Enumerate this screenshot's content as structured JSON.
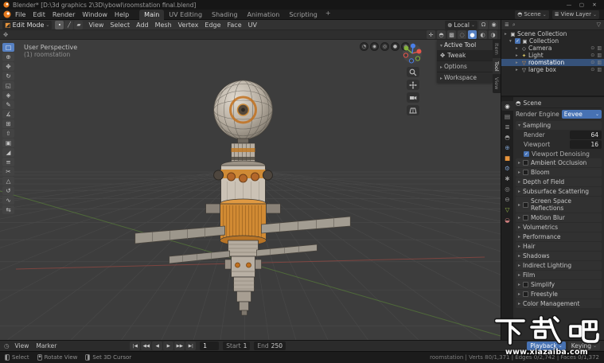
{
  "colors": {
    "accent_blue": "#4772b3",
    "accent_orange": "#e8953c",
    "selection_highlight": "#36527a",
    "axis_x_red": "#a84a42",
    "axis_y_green": "#5f8f38",
    "viewport_background": "#3d3d3d"
  },
  "titlebar": {
    "title": "Blender* [D:\\3d graphics 2\\3D\\ybowl\\roomstation final.blend]",
    "minimize_label": "—",
    "maximize_label": "▢",
    "close_label": "✕"
  },
  "menubar": {
    "menus": [
      "File",
      "Edit",
      "Render",
      "Window",
      "Help"
    ],
    "tabs": [
      "Main",
      "UV Editing",
      "Shading",
      "Animation",
      "Scripting"
    ],
    "active_tab": "Main",
    "add_tab_label": "+",
    "scene_label": "Scene",
    "view_layer_label": "View Layer"
  },
  "viewport_header": {
    "mode_label": "Edit Mode",
    "menus": [
      "View",
      "Select",
      "Add",
      "Mesh",
      "Vertex",
      "Edge",
      "Face",
      "UV"
    ],
    "orientation_label": "Local"
  },
  "toolbar": {
    "tools": [
      {
        "name": "select-box",
        "glyph": "□"
      },
      {
        "name": "cursor",
        "glyph": "⊕"
      },
      {
        "name": "move",
        "glyph": "✥"
      },
      {
        "name": "rotate",
        "glyph": "↻"
      },
      {
        "name": "scale",
        "glyph": "◱"
      },
      {
        "name": "transform",
        "glyph": "◈"
      },
      {
        "name": "annotate",
        "glyph": "✎"
      },
      {
        "name": "measure",
        "glyph": "∡"
      },
      {
        "name": "add-cube",
        "glyph": "⊞"
      },
      {
        "name": "extrude-region",
        "glyph": "⇧"
      },
      {
        "name": "inset-faces",
        "glyph": "▣"
      },
      {
        "name": "bevel",
        "glyph": "◢"
      },
      {
        "name": "loop-cut",
        "glyph": "≡"
      },
      {
        "name": "knife",
        "glyph": "✂"
      },
      {
        "name": "poly-build",
        "glyph": "△"
      },
      {
        "name": "spin",
        "glyph": "↺"
      },
      {
        "name": "smooth",
        "glyph": "∿"
      },
      {
        "name": "edge-slide",
        "glyph": "⇆"
      }
    ]
  },
  "viewport": {
    "overlay_line1": "User Perspective",
    "overlay_line2": "(1) roomstation",
    "float_buttons": [
      {
        "name": "toggle-xray",
        "glyph": "◔"
      },
      {
        "name": "show-gizmos",
        "glyph": "◉"
      },
      {
        "name": "show-overlays",
        "glyph": "◎"
      },
      {
        "name": "shading-solid",
        "glyph": "●"
      },
      {
        "name": "shading-material",
        "glyph": "◍"
      }
    ]
  },
  "npanel": {
    "title": "Active Tool",
    "tool_name": "Tweak",
    "sections": [
      "Options",
      "Workspace"
    ],
    "tabs": [
      "Item",
      "Tool",
      "View"
    ],
    "active_tab": "Tool"
  },
  "outliner": {
    "rows": [
      {
        "name": "Scene Collection",
        "type": "collection"
      },
      {
        "name": "Collection",
        "type": "collection"
      },
      {
        "name": "Camera",
        "type": "camera"
      },
      {
        "name": "Light",
        "type": "light"
      },
      {
        "name": "roomstation",
        "type": "mesh",
        "selected": true
      },
      {
        "name": "large box",
        "type": "mesh"
      }
    ]
  },
  "properties": {
    "breadcrumb": "Scene",
    "render_engine_label": "Render Engine",
    "render_engine_value": "Eevee",
    "sampling": {
      "title": "Sampling",
      "render_label": "Render",
      "render_value": "64",
      "viewport_label": "Viewport",
      "viewport_value": "16",
      "denoising_label": "Viewport Denoising",
      "denoising_checked": true
    },
    "sections": [
      {
        "label": "Ambient Occlusion",
        "checkbox": true
      },
      {
        "label": "Bloom",
        "checkbox": true
      },
      {
        "label": "Depth of Field",
        "checkbox": false
      },
      {
        "label": "Subsurface Scattering",
        "checkbox": false
      },
      {
        "label": "Screen Space Reflections",
        "checkbox": true
      },
      {
        "label": "Motion Blur",
        "checkbox": true
      },
      {
        "label": "Volumetrics",
        "checkbox": false
      },
      {
        "label": "Performance",
        "checkbox": false
      },
      {
        "label": "Hair",
        "checkbox": false
      },
      {
        "label": "Shadows",
        "checkbox": false
      },
      {
        "label": "Indirect Lighting",
        "checkbox": false
      },
      {
        "label": "Film",
        "checkbox": false
      },
      {
        "label": "Simplify",
        "checkbox": true
      },
      {
        "label": "Freestyle",
        "checkbox": true
      },
      {
        "label": "Color Management",
        "checkbox": false
      }
    ],
    "tabs": [
      {
        "name": "render",
        "glyph": "◉"
      },
      {
        "name": "output",
        "glyph": "▤"
      },
      {
        "name": "view-layer",
        "glyph": "≣"
      },
      {
        "name": "scene",
        "glyph": "◓"
      },
      {
        "name": "world",
        "glyph": "⊕"
      },
      {
        "name": "object",
        "glyph": "■"
      },
      {
        "name": "modifiers",
        "glyph": "⚙"
      },
      {
        "name": "particles",
        "glyph": "✱"
      },
      {
        "name": "physics",
        "glyph": "◎"
      },
      {
        "name": "constraints",
        "glyph": "⊖"
      },
      {
        "name": "object-data",
        "glyph": "▽"
      },
      {
        "name": "material",
        "glyph": "◒"
      }
    ]
  },
  "timeline": {
    "left_menus": [
      "View",
      "Marker"
    ],
    "transport": [
      "|◀",
      "◀◀",
      "◀",
      "▶",
      "▶▶",
      "▶|"
    ],
    "current_frame": "1",
    "start_label": "Start",
    "start_value": "1",
    "end_label": "End",
    "end_value": "250",
    "right_menus": [
      "Playback",
      "Keying"
    ]
  },
  "statusbar": {
    "hints": [
      "Select",
      "Rotate View",
      "Set 3D Cursor"
    ],
    "stats": "roomstation | Verts 80/1,371 | Edges 0/2,742 | Faces 0/1,372"
  },
  "watermark": {
    "text": "下载吧",
    "url": "www.xiazaiba.com"
  },
  "icons": {
    "magnet": "Ω",
    "proportional": "◉",
    "orientation_globe": "⊕",
    "gizmo": "✛",
    "overlays": "◓",
    "xray": "▩",
    "shading_wireframe": "◌",
    "shading_solid": "●",
    "shading_material": "◐",
    "shading_rendered": "◑",
    "vertex_mode": "∙",
    "edge_mode": "╱",
    "face_mode": "▰",
    "editmode": "◩",
    "caret": "⌄",
    "arrow_right": "▸",
    "arrow_down": "▾",
    "scene": "◓",
    "view_layer": "≣",
    "filter": "▽",
    "search": "⌕",
    "eye": "⊙",
    "render_visibility": "▥",
    "collection": "▣",
    "camera_obj": "◇",
    "light_obj": "✦",
    "mesh_obj": "▽",
    "clock": "◷",
    "tool_tweak": "✥",
    "check": "✓"
  }
}
